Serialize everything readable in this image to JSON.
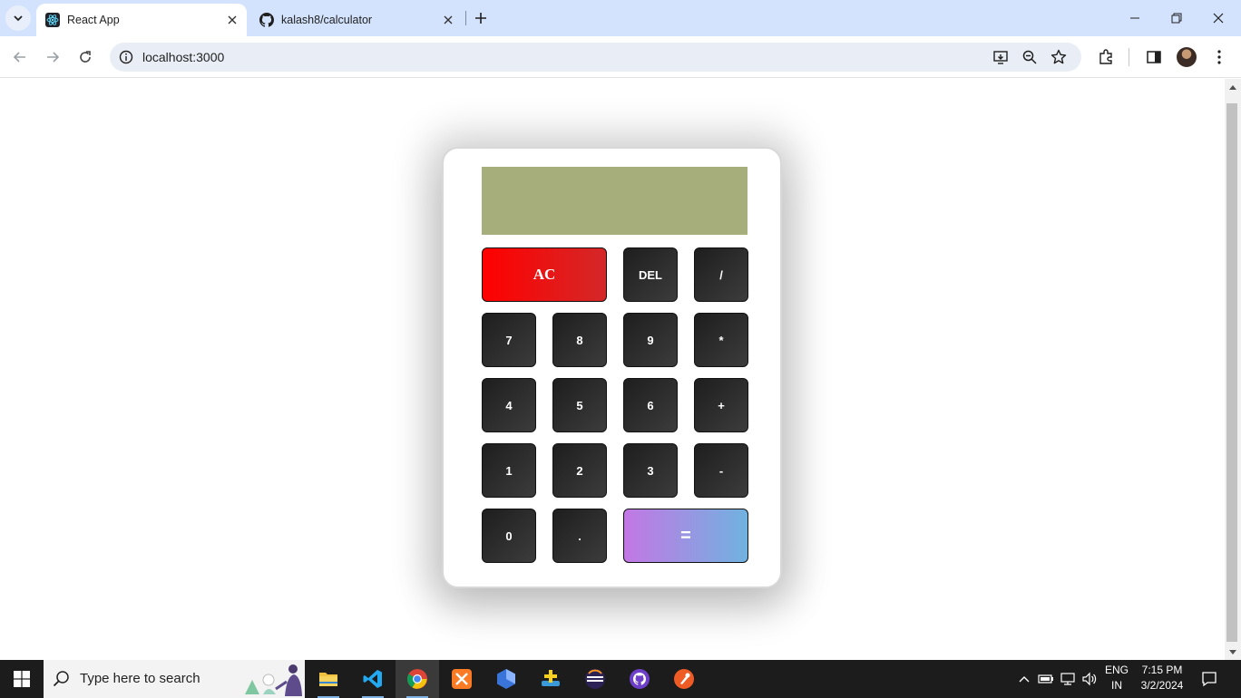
{
  "browser": {
    "tabs": [
      {
        "title": "React App",
        "active": true,
        "favicon": "react-icon"
      },
      {
        "title": "kalash8/calculator",
        "active": false,
        "favicon": "github-icon"
      }
    ],
    "url": "localhost:3000"
  },
  "calculator": {
    "display": "",
    "keys": {
      "ac": "AC",
      "del": "DEL",
      "divide": "/",
      "seven": "7",
      "eight": "8",
      "nine": "9",
      "multiply": "*",
      "four": "4",
      "five": "5",
      "six": "6",
      "plus": "+",
      "one": "1",
      "two": "2",
      "three": "3",
      "minus": "-",
      "zero": "0",
      "dot": ".",
      "equals": "="
    },
    "colors": {
      "display_bg": "#a6af7b",
      "ac_start": "#ff0000",
      "ac_end": "#d42828",
      "equals_start": "#c377e4",
      "equals_end": "#70b2e0",
      "key_dark": "#2a2a2a"
    }
  },
  "taskbar": {
    "search_placeholder": "Type here to search",
    "apps": [
      "file-explorer-icon",
      "vscode-icon",
      "chrome-icon",
      "xampp-icon",
      "dev-app-icon",
      "game-app-icon",
      "eclipse-icon",
      "github-desktop-icon",
      "postman-icon"
    ],
    "language_top": "ENG",
    "language_bottom": "IN",
    "time": "7:15 PM",
    "date": "3/2/2024"
  }
}
